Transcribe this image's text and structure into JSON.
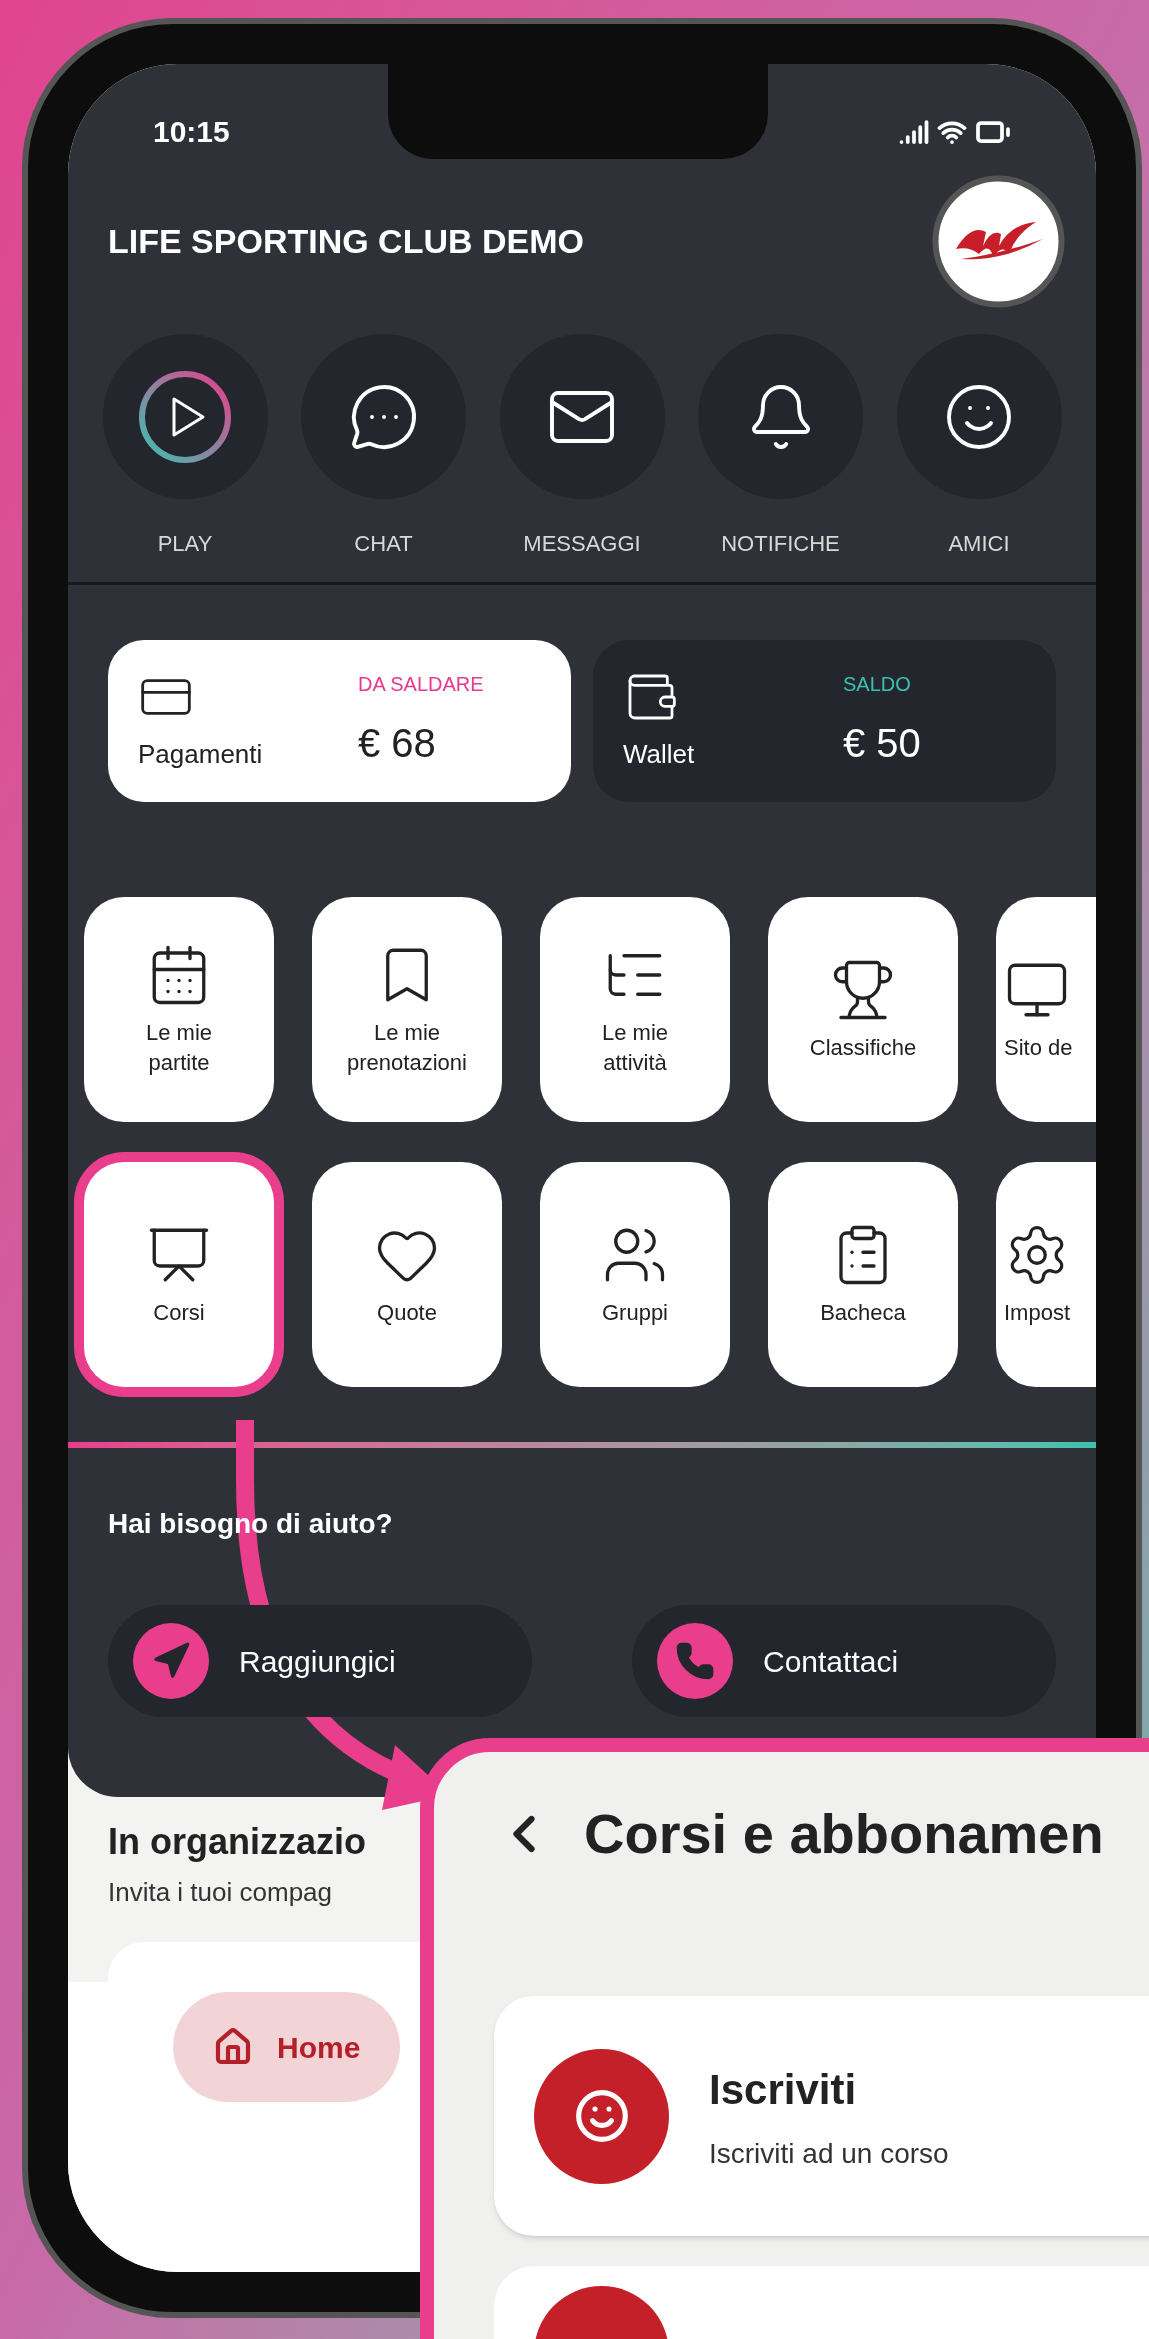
{
  "status_bar": {
    "time": "10:15"
  },
  "header": {
    "title": "LIFE SPORTING CLUB DEMO"
  },
  "quick_actions": [
    {
      "label": "PLAY",
      "kind": "play"
    },
    {
      "label": "CHAT",
      "kind": "chat"
    },
    {
      "label": "MESSAGGI",
      "kind": "mail"
    },
    {
      "label": "NOTIFICHE",
      "kind": "bell"
    },
    {
      "label": "AMICI",
      "kind": "smile"
    }
  ],
  "balance_cards": [
    {
      "kind": "light",
      "label": "Pagamenti",
      "caption": "DA SALDARE",
      "amount": "€ 68",
      "color": "#e6398f"
    },
    {
      "kind": "dark",
      "label": "Wallet",
      "caption": "SALDO",
      "amount": "€ 50",
      "color": "#3cc1b0"
    }
  ],
  "tiles": [
    {
      "label": "Le mie\npartite",
      "selected": false
    },
    {
      "label": "Le mie\nprenotazioni",
      "selected": false
    },
    {
      "label": "Le mie\nattività",
      "selected": false
    },
    {
      "label": "Classifiche",
      "selected": false
    },
    {
      "label": "Sito de",
      "selected": false
    },
    {
      "label": "Corsi",
      "selected": true
    },
    {
      "label": "Quote",
      "selected": false
    },
    {
      "label": "Gruppi",
      "selected": false
    },
    {
      "label": "Bacheca",
      "selected": false
    },
    {
      "label": "Impost",
      "selected": false
    }
  ],
  "help": {
    "title": "Hai bisogno di aiuto?",
    "actions": [
      {
        "label": "Raggiungici",
        "kind": "navigate"
      },
      {
        "label": "Contattaci",
        "kind": "phone"
      }
    ]
  },
  "organizing": {
    "title": "In organizzazio",
    "subtitle": "Invita i tuoi compag"
  },
  "bottom_nav": [
    {
      "label": "Home",
      "selected": true
    }
  ],
  "detail_panel": {
    "title": "Corsi e abbonamen",
    "items": [
      {
        "title": "Iscriviti",
        "subtitle": "Iscriviti ad un corso"
      }
    ]
  }
}
